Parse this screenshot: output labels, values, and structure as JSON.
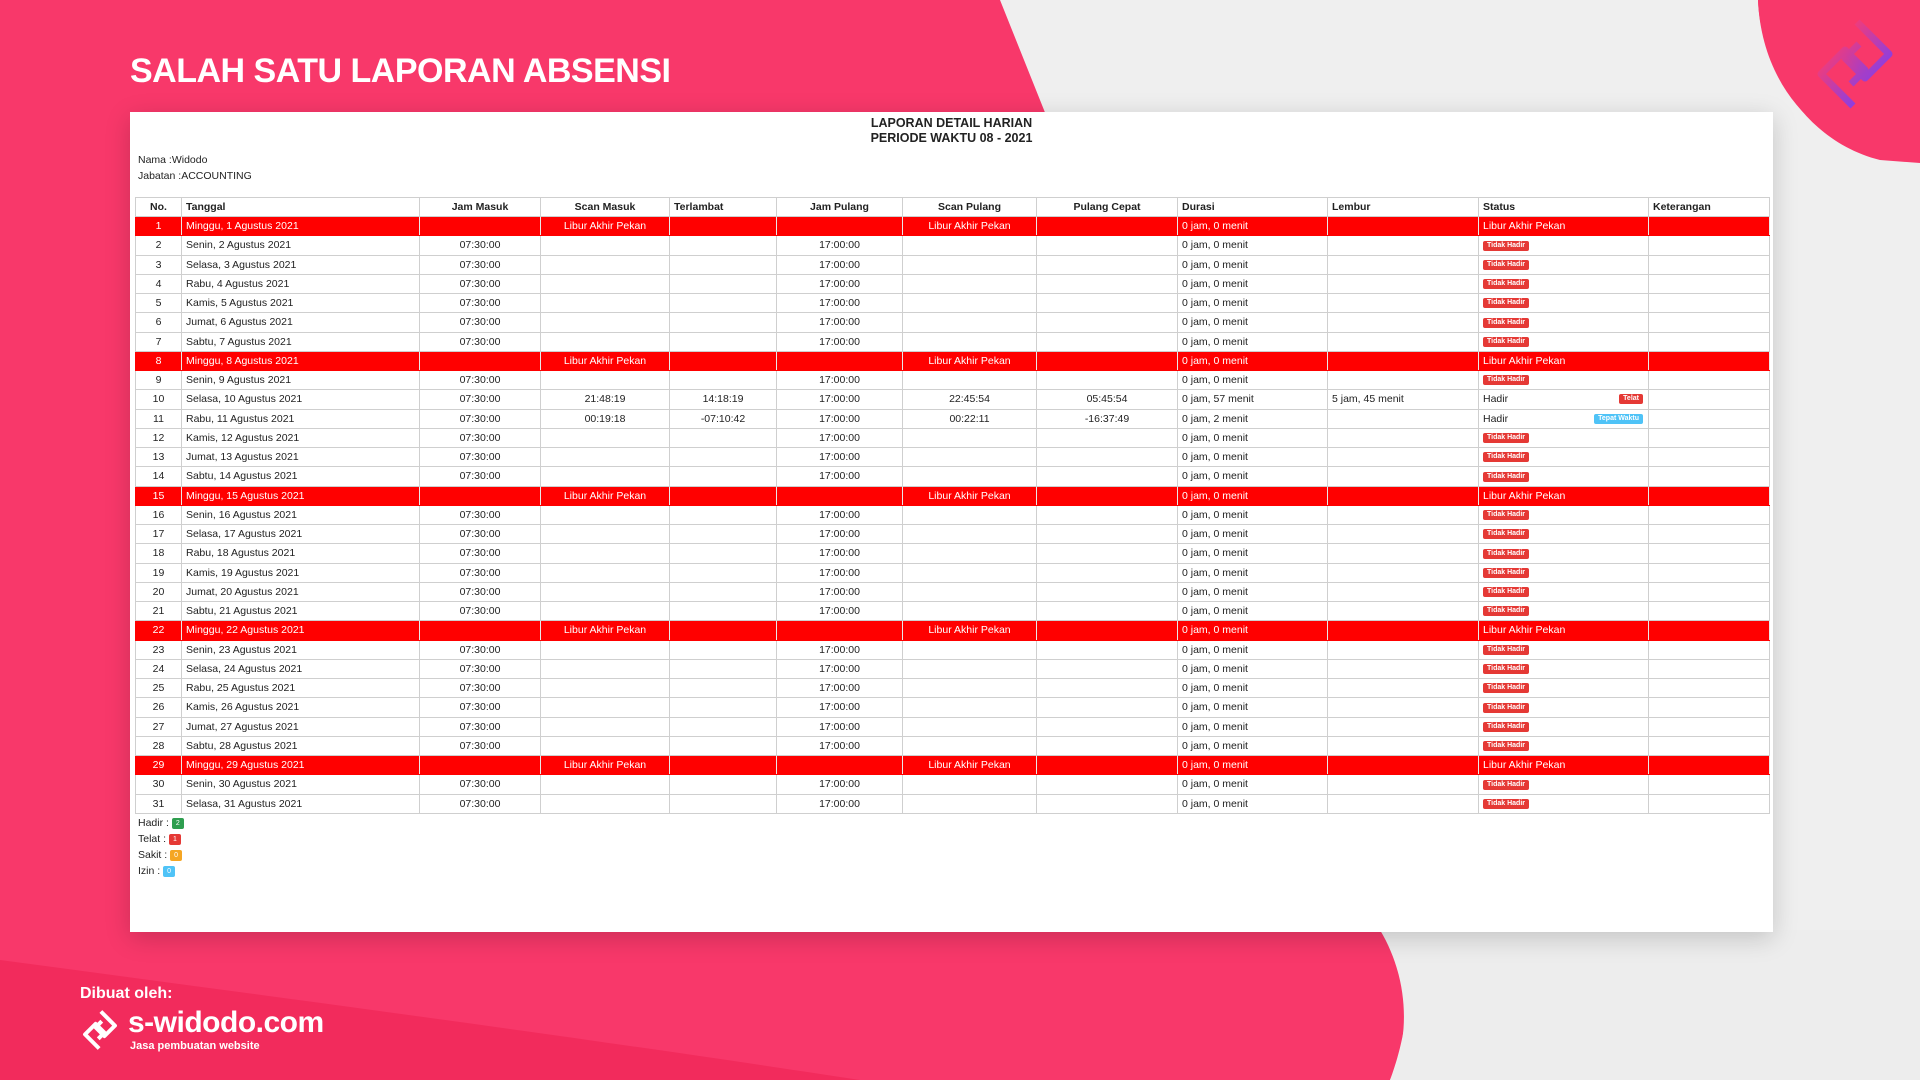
{
  "headline": "SALAH SATU LAPORAN ABSENSI",
  "report": {
    "title_line1": "LAPORAN DETAIL HARIAN",
    "title_line2": "PERIODE WAKTU 08 - 2021",
    "nama_label": "Nama : ",
    "nama_value": "Widodo",
    "jabatan_label": "Jabatan : ",
    "jabatan_value": "ACCOUNTING",
    "columns": [
      "No.",
      "Tanggal",
      "Jam Masuk",
      "Scan Masuk",
      "Terlambat",
      "Jam Pulang",
      "Scan Pulang",
      "Pulang Cepat",
      "Durasi",
      "Lembur",
      "Status",
      "Keterangan"
    ],
    "rows": [
      {
        "no": "1",
        "tanggal": "Minggu, 1 Agustus 2021",
        "weekend": true,
        "jam_masuk": "",
        "scan_masuk": "Libur Akhir Pekan",
        "terlambat": "",
        "jam_pulang": "",
        "scan_pulang": "Libur Akhir Pekan",
        "pulang_cepat": "",
        "durasi": "0 jam, 0 menit",
        "lembur": "",
        "status": "Libur Akhir Pekan",
        "badge": "",
        "keterangan": ""
      },
      {
        "no": "2",
        "tanggal": "Senin, 2 Agustus 2021",
        "weekend": false,
        "jam_masuk": "07:30:00",
        "scan_masuk": "",
        "terlambat": "",
        "jam_pulang": "17:00:00",
        "scan_pulang": "",
        "pulang_cepat": "",
        "durasi": "0 jam, 0 menit",
        "lembur": "",
        "status": "",
        "badge": "Tidak Hadir",
        "keterangan": ""
      },
      {
        "no": "3",
        "tanggal": "Selasa, 3 Agustus 2021",
        "weekend": false,
        "jam_masuk": "07:30:00",
        "scan_masuk": "",
        "terlambat": "",
        "jam_pulang": "17:00:00",
        "scan_pulang": "",
        "pulang_cepat": "",
        "durasi": "0 jam, 0 menit",
        "lembur": "",
        "status": "",
        "badge": "Tidak Hadir",
        "keterangan": ""
      },
      {
        "no": "4",
        "tanggal": "Rabu, 4 Agustus 2021",
        "weekend": false,
        "jam_masuk": "07:30:00",
        "scan_masuk": "",
        "terlambat": "",
        "jam_pulang": "17:00:00",
        "scan_pulang": "",
        "pulang_cepat": "",
        "durasi": "0 jam, 0 menit",
        "lembur": "",
        "status": "",
        "badge": "Tidak Hadir",
        "keterangan": ""
      },
      {
        "no": "5",
        "tanggal": "Kamis, 5 Agustus 2021",
        "weekend": false,
        "jam_masuk": "07:30:00",
        "scan_masuk": "",
        "terlambat": "",
        "jam_pulang": "17:00:00",
        "scan_pulang": "",
        "pulang_cepat": "",
        "durasi": "0 jam, 0 menit",
        "lembur": "",
        "status": "",
        "badge": "Tidak Hadir",
        "keterangan": ""
      },
      {
        "no": "6",
        "tanggal": "Jumat, 6 Agustus 2021",
        "weekend": false,
        "jam_masuk": "07:30:00",
        "scan_masuk": "",
        "terlambat": "",
        "jam_pulang": "17:00:00",
        "scan_pulang": "",
        "pulang_cepat": "",
        "durasi": "0 jam, 0 menit",
        "lembur": "",
        "status": "",
        "badge": "Tidak Hadir",
        "keterangan": ""
      },
      {
        "no": "7",
        "tanggal": "Sabtu, 7 Agustus 2021",
        "weekend": false,
        "jam_masuk": "07:30:00",
        "scan_masuk": "",
        "terlambat": "",
        "jam_pulang": "17:00:00",
        "scan_pulang": "",
        "pulang_cepat": "",
        "durasi": "0 jam, 0 menit",
        "lembur": "",
        "status": "",
        "badge": "Tidak Hadir",
        "keterangan": ""
      },
      {
        "no": "8",
        "tanggal": "Minggu, 8 Agustus 2021",
        "weekend": true,
        "jam_masuk": "",
        "scan_masuk": "Libur Akhir Pekan",
        "terlambat": "",
        "jam_pulang": "",
        "scan_pulang": "Libur Akhir Pekan",
        "pulang_cepat": "",
        "durasi": "0 jam, 0 menit",
        "lembur": "",
        "status": "Libur Akhir Pekan",
        "badge": "",
        "keterangan": ""
      },
      {
        "no": "9",
        "tanggal": "Senin, 9 Agustus 2021",
        "weekend": false,
        "jam_masuk": "07:30:00",
        "scan_masuk": "",
        "terlambat": "",
        "jam_pulang": "17:00:00",
        "scan_pulang": "",
        "pulang_cepat": "",
        "durasi": "0 jam, 0 menit",
        "lembur": "",
        "status": "",
        "badge": "Tidak Hadir",
        "keterangan": ""
      },
      {
        "no": "10",
        "tanggal": "Selasa, 10 Agustus 2021",
        "weekend": false,
        "jam_masuk": "07:30:00",
        "scan_masuk": "21:48:19",
        "terlambat": "14:18:19",
        "jam_pulang": "17:00:00",
        "scan_pulang": "22:45:54",
        "pulang_cepat": "05:45:54",
        "durasi": "0 jam, 57 menit",
        "lembur": "5 jam, 45 menit",
        "status": "Hadir",
        "badge": "Telat",
        "keterangan": ""
      },
      {
        "no": "11",
        "tanggal": "Rabu, 11 Agustus 2021",
        "weekend": false,
        "jam_masuk": "07:30:00",
        "scan_masuk": "00:19:18",
        "terlambat": "-07:10:42",
        "jam_pulang": "17:00:00",
        "scan_pulang": "00:22:11",
        "pulang_cepat": "-16:37:49",
        "durasi": "0 jam, 2 menit",
        "lembur": "",
        "status": "Hadir",
        "badge": "Tepat Waktu",
        "keterangan": ""
      },
      {
        "no": "12",
        "tanggal": "Kamis, 12 Agustus 2021",
        "weekend": false,
        "jam_masuk": "07:30:00",
        "scan_masuk": "",
        "terlambat": "",
        "jam_pulang": "17:00:00",
        "scan_pulang": "",
        "pulang_cepat": "",
        "durasi": "0 jam, 0 menit",
        "lembur": "",
        "status": "",
        "badge": "Tidak Hadir",
        "keterangan": ""
      },
      {
        "no": "13",
        "tanggal": "Jumat, 13 Agustus 2021",
        "weekend": false,
        "jam_masuk": "07:30:00",
        "scan_masuk": "",
        "terlambat": "",
        "jam_pulang": "17:00:00",
        "scan_pulang": "",
        "pulang_cepat": "",
        "durasi": "0 jam, 0 menit",
        "lembur": "",
        "status": "",
        "badge": "Tidak Hadir",
        "keterangan": ""
      },
      {
        "no": "14",
        "tanggal": "Sabtu, 14 Agustus 2021",
        "weekend": false,
        "jam_masuk": "07:30:00",
        "scan_masuk": "",
        "terlambat": "",
        "jam_pulang": "17:00:00",
        "scan_pulang": "",
        "pulang_cepat": "",
        "durasi": "0 jam, 0 menit",
        "lembur": "",
        "status": "",
        "badge": "Tidak Hadir",
        "keterangan": ""
      },
      {
        "no": "15",
        "tanggal": "Minggu, 15 Agustus 2021",
        "weekend": true,
        "jam_masuk": "",
        "scan_masuk": "Libur Akhir Pekan",
        "terlambat": "",
        "jam_pulang": "",
        "scan_pulang": "Libur Akhir Pekan",
        "pulang_cepat": "",
        "durasi": "0 jam, 0 menit",
        "lembur": "",
        "status": "Libur Akhir Pekan",
        "badge": "",
        "keterangan": ""
      },
      {
        "no": "16",
        "tanggal": "Senin, 16 Agustus 2021",
        "weekend": false,
        "jam_masuk": "07:30:00",
        "scan_masuk": "",
        "terlambat": "",
        "jam_pulang": "17:00:00",
        "scan_pulang": "",
        "pulang_cepat": "",
        "durasi": "0 jam, 0 menit",
        "lembur": "",
        "status": "",
        "badge": "Tidak Hadir",
        "keterangan": ""
      },
      {
        "no": "17",
        "tanggal": "Selasa, 17 Agustus 2021",
        "weekend": false,
        "jam_masuk": "07:30:00",
        "scan_masuk": "",
        "terlambat": "",
        "jam_pulang": "17:00:00",
        "scan_pulang": "",
        "pulang_cepat": "",
        "durasi": "0 jam, 0 menit",
        "lembur": "",
        "status": "",
        "badge": "Tidak Hadir",
        "keterangan": ""
      },
      {
        "no": "18",
        "tanggal": "Rabu, 18 Agustus 2021",
        "weekend": false,
        "jam_masuk": "07:30:00",
        "scan_masuk": "",
        "terlambat": "",
        "jam_pulang": "17:00:00",
        "scan_pulang": "",
        "pulang_cepat": "",
        "durasi": "0 jam, 0 menit",
        "lembur": "",
        "status": "",
        "badge": "Tidak Hadir",
        "keterangan": ""
      },
      {
        "no": "19",
        "tanggal": "Kamis, 19 Agustus 2021",
        "weekend": false,
        "jam_masuk": "07:30:00",
        "scan_masuk": "",
        "terlambat": "",
        "jam_pulang": "17:00:00",
        "scan_pulang": "",
        "pulang_cepat": "",
        "durasi": "0 jam, 0 menit",
        "lembur": "",
        "status": "",
        "badge": "Tidak Hadir",
        "keterangan": ""
      },
      {
        "no": "20",
        "tanggal": "Jumat, 20 Agustus 2021",
        "weekend": false,
        "jam_masuk": "07:30:00",
        "scan_masuk": "",
        "terlambat": "",
        "jam_pulang": "17:00:00",
        "scan_pulang": "",
        "pulang_cepat": "",
        "durasi": "0 jam, 0 menit",
        "lembur": "",
        "status": "",
        "badge": "Tidak Hadir",
        "keterangan": ""
      },
      {
        "no": "21",
        "tanggal": "Sabtu, 21 Agustus 2021",
        "weekend": false,
        "jam_masuk": "07:30:00",
        "scan_masuk": "",
        "terlambat": "",
        "jam_pulang": "17:00:00",
        "scan_pulang": "",
        "pulang_cepat": "",
        "durasi": "0 jam, 0 menit",
        "lembur": "",
        "status": "",
        "badge": "Tidak Hadir",
        "keterangan": ""
      },
      {
        "no": "22",
        "tanggal": "Minggu, 22 Agustus 2021",
        "weekend": true,
        "jam_masuk": "",
        "scan_masuk": "Libur Akhir Pekan",
        "terlambat": "",
        "jam_pulang": "",
        "scan_pulang": "Libur Akhir Pekan",
        "pulang_cepat": "",
        "durasi": "0 jam, 0 menit",
        "lembur": "",
        "status": "Libur Akhir Pekan",
        "badge": "",
        "keterangan": ""
      },
      {
        "no": "23",
        "tanggal": "Senin, 23 Agustus 2021",
        "weekend": false,
        "jam_masuk": "07:30:00",
        "scan_masuk": "",
        "terlambat": "",
        "jam_pulang": "17:00:00",
        "scan_pulang": "",
        "pulang_cepat": "",
        "durasi": "0 jam, 0 menit",
        "lembur": "",
        "status": "",
        "badge": "Tidak Hadir",
        "keterangan": ""
      },
      {
        "no": "24",
        "tanggal": "Selasa, 24 Agustus 2021",
        "weekend": false,
        "jam_masuk": "07:30:00",
        "scan_masuk": "",
        "terlambat": "",
        "jam_pulang": "17:00:00",
        "scan_pulang": "",
        "pulang_cepat": "",
        "durasi": "0 jam, 0 menit",
        "lembur": "",
        "status": "",
        "badge": "Tidak Hadir",
        "keterangan": ""
      },
      {
        "no": "25",
        "tanggal": "Rabu, 25 Agustus 2021",
        "weekend": false,
        "jam_masuk": "07:30:00",
        "scan_masuk": "",
        "terlambat": "",
        "jam_pulang": "17:00:00",
        "scan_pulang": "",
        "pulang_cepat": "",
        "durasi": "0 jam, 0 menit",
        "lembur": "",
        "status": "",
        "badge": "Tidak Hadir",
        "keterangan": ""
      },
      {
        "no": "26",
        "tanggal": "Kamis, 26 Agustus 2021",
        "weekend": false,
        "jam_masuk": "07:30:00",
        "scan_masuk": "",
        "terlambat": "",
        "jam_pulang": "17:00:00",
        "scan_pulang": "",
        "pulang_cepat": "",
        "durasi": "0 jam, 0 menit",
        "lembur": "",
        "status": "",
        "badge": "Tidak Hadir",
        "keterangan": ""
      },
      {
        "no": "27",
        "tanggal": "Jumat, 27 Agustus 2021",
        "weekend": false,
        "jam_masuk": "07:30:00",
        "scan_masuk": "",
        "terlambat": "",
        "jam_pulang": "17:00:00",
        "scan_pulang": "",
        "pulang_cepat": "",
        "durasi": "0 jam, 0 menit",
        "lembur": "",
        "status": "",
        "badge": "Tidak Hadir",
        "keterangan": ""
      },
      {
        "no": "28",
        "tanggal": "Sabtu, 28 Agustus 2021",
        "weekend": false,
        "jam_masuk": "07:30:00",
        "scan_masuk": "",
        "terlambat": "",
        "jam_pulang": "17:00:00",
        "scan_pulang": "",
        "pulang_cepat": "",
        "durasi": "0 jam, 0 menit",
        "lembur": "",
        "status": "",
        "badge": "Tidak Hadir",
        "keterangan": ""
      },
      {
        "no": "29",
        "tanggal": "Minggu, 29 Agustus 2021",
        "weekend": true,
        "jam_masuk": "",
        "scan_masuk": "Libur Akhir Pekan",
        "terlambat": "",
        "jam_pulang": "",
        "scan_pulang": "Libur Akhir Pekan",
        "pulang_cepat": "",
        "durasi": "0 jam, 0 menit",
        "lembur": "",
        "status": "Libur Akhir Pekan",
        "badge": "",
        "keterangan": ""
      },
      {
        "no": "30",
        "tanggal": "Senin, 30 Agustus 2021",
        "weekend": false,
        "jam_masuk": "07:30:00",
        "scan_masuk": "",
        "terlambat": "",
        "jam_pulang": "17:00:00",
        "scan_pulang": "",
        "pulang_cepat": "",
        "durasi": "0 jam, 0 menit",
        "lembur": "",
        "status": "",
        "badge": "Tidak Hadir",
        "keterangan": ""
      },
      {
        "no": "31",
        "tanggal": "Selasa, 31 Agustus 2021",
        "weekend": false,
        "jam_masuk": "07:30:00",
        "scan_masuk": "",
        "terlambat": "",
        "jam_pulang": "17:00:00",
        "scan_pulang": "",
        "pulang_cepat": "",
        "durasi": "0 jam, 0 menit",
        "lembur": "",
        "status": "",
        "badge": "Tidak Hadir",
        "keterangan": ""
      }
    ],
    "legend": [
      {
        "label": "Hadir : ",
        "count": "2",
        "color": "#2e9e4f"
      },
      {
        "label": "Telat : ",
        "count": "1",
        "color": "#e53935"
      },
      {
        "label": "Sakit : ",
        "count": "0",
        "color": "#f5a623"
      },
      {
        "label": "Izin : ",
        "count": "0",
        "color": "#4fc3f7"
      }
    ]
  },
  "footer": {
    "by": "Dibuat oleh:",
    "site": "s-widodo.com",
    "tagline": "Jasa pembuatan website"
  },
  "colors": {
    "brand": "#f8386a",
    "weekend_row": "#ff0000",
    "badge_red": "#e53935",
    "badge_cyan": "#4fc3f7",
    "logo_gradient": [
      "#ff3b6b",
      "#7b3ff2"
    ]
  }
}
